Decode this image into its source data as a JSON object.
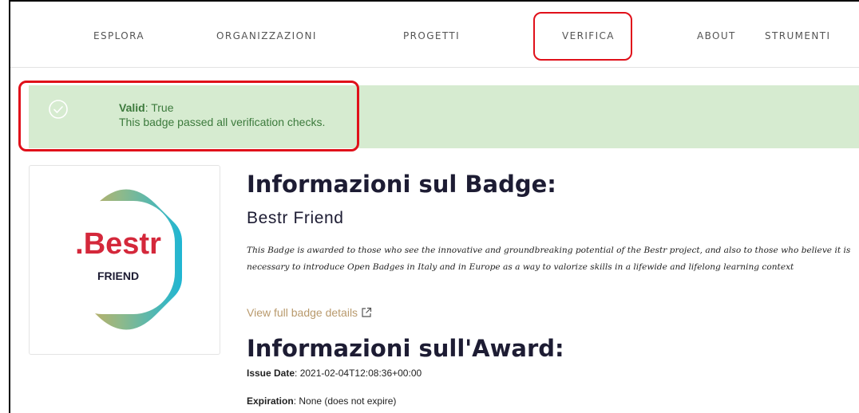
{
  "nav": {
    "items": [
      "ESPLORA",
      "ORGANIZZAZIONI",
      "PROGETTI",
      "VERIFICA",
      "ABOUT",
      "STRUMENTI"
    ]
  },
  "alert": {
    "valid_label": "Valid",
    "valid_value": ": True",
    "message": "This badge passed all verification checks.",
    "icon": "check-circle-icon"
  },
  "badge": {
    "logo_text": ".Bestr",
    "logo_subtext": "FRIEND",
    "section_title": "Informazioni sul Badge:",
    "name": "Bestr Friend",
    "description": "This Badge is awarded to those who see the innovative and groundbreaking potential of the Bestr project, and also to those who believe it is necessary to introduce Open Badges in Italy and in Europe as a way to valorize skills in a lifewide and lifelong learning context",
    "details_link": "View full badge details"
  },
  "award": {
    "section_title": "Informazioni sull'Award:",
    "issue_label": "Issue Date",
    "issue_value": ": 2021-02-04T12:08:36+00:00",
    "expiration_label": "Expiration",
    "expiration_value": ": None (does not expire)"
  },
  "colors": {
    "alert_bg": "#d6ebd0",
    "alert_text": "#3c7a3c",
    "highlight": "#e0101a",
    "brand_red": "#d4283b",
    "link": "#b99a6d",
    "heading": "#1d1c33"
  }
}
